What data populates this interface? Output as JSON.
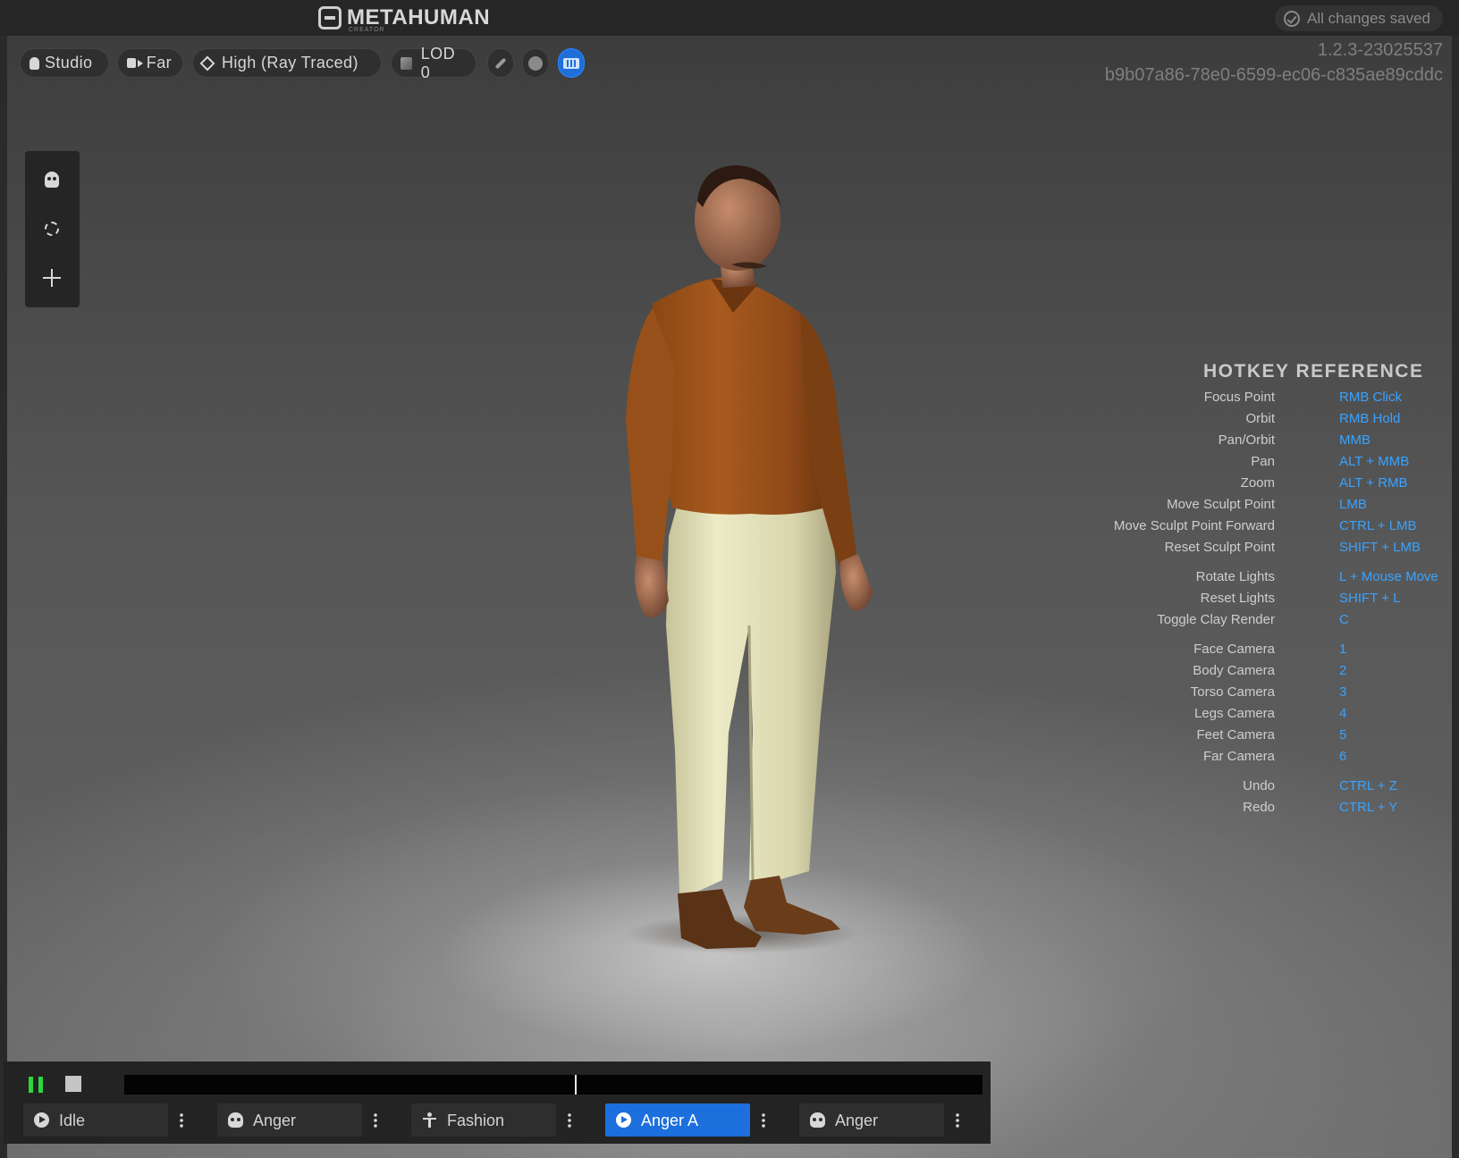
{
  "app": {
    "logo_text": "METAHUMAN",
    "logo_subtext": "CREATOR",
    "save_status": "All changes saved",
    "version": "1.2.3-23025537",
    "asset_id": "b9b07a86-78e0-6599-ec06-c835ae89cddc"
  },
  "toolbar": {
    "lighting": "Studio",
    "camera": "Far",
    "quality": "High (Ray Traced)",
    "lod": "LOD 0",
    "icons": [
      "brush-icon",
      "clay-icon",
      "keyboard-icon"
    ],
    "active_toggle": "keyboard-icon",
    "accent_color": "#1e6fd9"
  },
  "left_tools": [
    "face-sculpt-icon",
    "rotate-icon",
    "move-icon"
  ],
  "hotkeys": {
    "title": "HOTKEY REFERENCE",
    "key_color": "#39a3ff",
    "groups": [
      [
        {
          "action": "Focus Point",
          "key": "RMB Click"
        },
        {
          "action": "Orbit",
          "key": "RMB Hold"
        },
        {
          "action": "Pan/Orbit",
          "key": "MMB"
        },
        {
          "action": "Pan",
          "key": "ALT + MMB"
        },
        {
          "action": "Zoom",
          "key": "ALT + RMB"
        },
        {
          "action": "Move Sculpt Point",
          "key": "LMB"
        },
        {
          "action": "Move Sculpt Point Forward",
          "key": "CTRL + LMB"
        },
        {
          "action": "Reset Sculpt Point",
          "key": "SHIFT + LMB"
        }
      ],
      [
        {
          "action": "Rotate Lights",
          "key": "L + Mouse Move"
        },
        {
          "action": "Reset Lights",
          "key": "SHIFT + L"
        },
        {
          "action": "Toggle Clay Render",
          "key": "C"
        }
      ],
      [
        {
          "action": "Face Camera",
          "key": "1"
        },
        {
          "action": "Body Camera",
          "key": "2"
        },
        {
          "action": "Torso Camera",
          "key": "3"
        },
        {
          "action": "Legs Camera",
          "key": "4"
        },
        {
          "action": "Feet Camera",
          "key": "5"
        },
        {
          "action": "Far Camera",
          "key": "6"
        }
      ],
      [
        {
          "action": "Undo",
          "key": "CTRL + Z"
        },
        {
          "action": "Redo",
          "key": "CTRL + Y"
        }
      ]
    ]
  },
  "timeline": {
    "playing": true,
    "progress": 0.525,
    "play_color": "#2fd53b",
    "clips": [
      {
        "label": "Idle",
        "icon": "play-circle-icon",
        "active": false
      },
      {
        "label": "Anger",
        "icon": "face-icon",
        "active": false
      },
      {
        "label": "Fashion",
        "icon": "person-icon",
        "active": false
      },
      {
        "label": "Anger A",
        "icon": "play-circle-icon",
        "active": true
      },
      {
        "label": "Anger",
        "icon": "face-icon",
        "active": false
      }
    ]
  }
}
